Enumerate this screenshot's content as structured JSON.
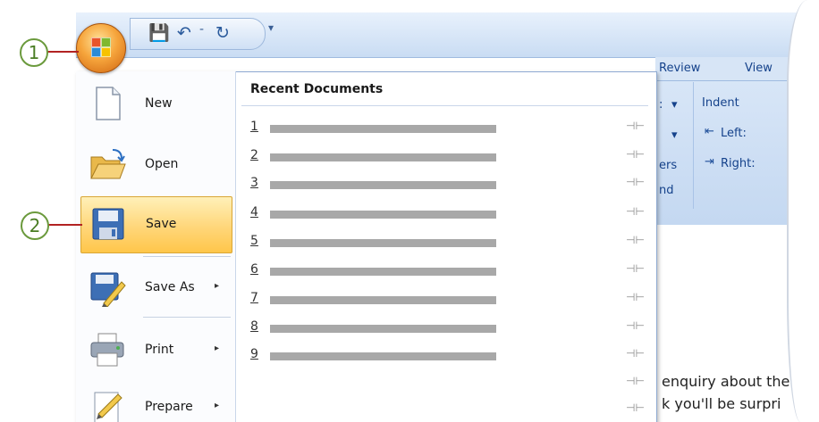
{
  "qat": {
    "save_glyph": "💾",
    "undo_glyph": "↶",
    "separator": "-",
    "redo_glyph": "↻",
    "customize_glyph": "▾"
  },
  "ribbon": {
    "tabs": [
      "Review",
      "View"
    ],
    "partial_labels": [
      ":",
      "▾",
      "▾",
      "ers",
      "nd"
    ],
    "indent": {
      "title": "Indent",
      "left": "Left:",
      "right": "Right:"
    }
  },
  "document": {
    "lines": [
      "enquiry about the",
      "k you'll be surpri"
    ]
  },
  "callouts": [
    "1",
    "2"
  ],
  "menu": {
    "items": [
      {
        "label": "New",
        "icon": "new-document-icon",
        "submenu": false
      },
      {
        "label": "Open",
        "icon": "open-folder-icon",
        "submenu": false
      },
      {
        "label": "Save",
        "icon": "save-disk-icon",
        "submenu": false
      },
      {
        "label": "Save As",
        "icon": "save-as-icon",
        "submenu": true
      },
      {
        "label": "Print",
        "icon": "printer-icon",
        "submenu": true
      },
      {
        "label": "Prepare",
        "icon": "prepare-icon",
        "submenu": true
      }
    ],
    "recent_header": "Recent Documents",
    "recent": [
      "1",
      "2",
      "3",
      "4",
      "5",
      "6",
      "7",
      "8",
      "9"
    ],
    "pin_glyph": "⊣⊢",
    "submenu_arrow": "▸"
  },
  "colors": {
    "highlight": "#ffd679",
    "callout_ring": "#6b9a3d",
    "callout_line": "#b22222"
  }
}
